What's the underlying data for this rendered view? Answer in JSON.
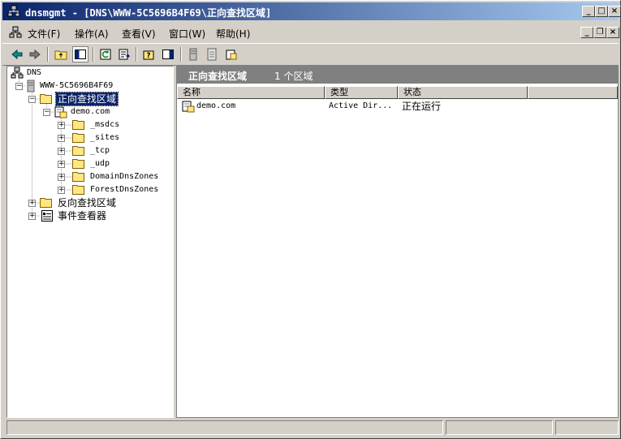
{
  "window": {
    "title": "dnsmgmt - [DNS\\WWW-5C5696B4F69\\正向查找区域]"
  },
  "title_buttons": {
    "minimize": "_",
    "maximize": "□",
    "close": "×"
  },
  "mdi_buttons": {
    "minimize": "_",
    "restore": "❐",
    "close": "×"
  },
  "menu": [
    {
      "label": "文件(F)"
    },
    {
      "label": "操作(A)"
    },
    {
      "label": "查看(V)"
    },
    {
      "label": "窗口(W)"
    },
    {
      "label": "帮助(H)"
    }
  ],
  "tree": {
    "root": "DNS",
    "server": "WWW-5C5696B4F69",
    "forward_zones": "正向查找区域",
    "zone": "demo.com",
    "subfolders": [
      "_msdcs",
      "_sites",
      "_tcp",
      "_udp",
      "DomainDnsZones",
      "ForestDnsZones"
    ],
    "reverse_zones": "反向查找区域",
    "event_viewer": "事件查看器"
  },
  "detail": {
    "title": "正向查找区域",
    "count": "1 个区域",
    "columns": [
      "名称",
      "类型",
      "状态"
    ],
    "rows": [
      {
        "name": "demo.com",
        "type": "Active Dir...",
        "status": "正在运行"
      }
    ]
  },
  "colors": {
    "title_start": "#0a246a",
    "title_end": "#a6caf0",
    "selection": "#0a246a",
    "face": "#d4d0c8"
  }
}
